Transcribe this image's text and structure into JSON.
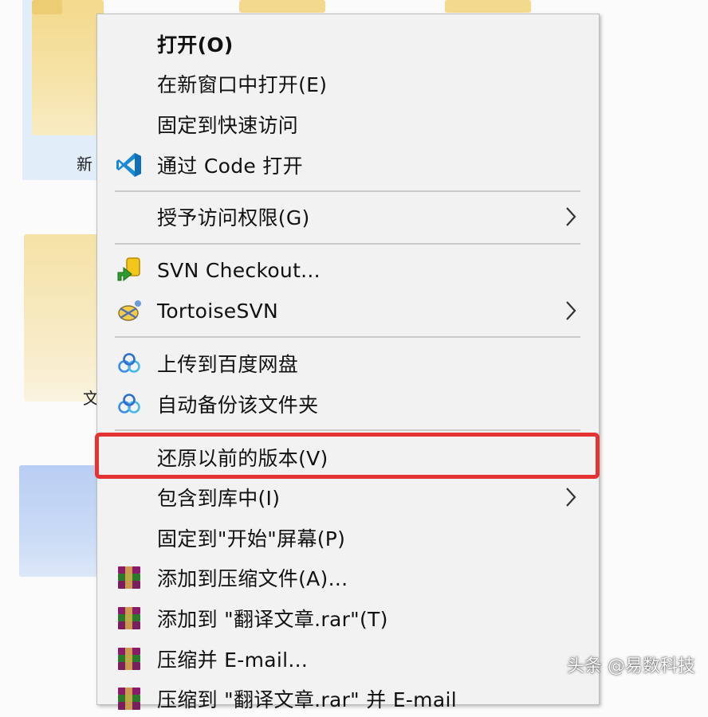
{
  "background": {
    "label_1": "新",
    "label_2": "文"
  },
  "menu": {
    "items": [
      {
        "label": "打开(O)",
        "icon": "none"
      },
      {
        "label": "在新窗口中打开(E)",
        "icon": "none"
      },
      {
        "label": "固定到快速访问",
        "icon": "none"
      },
      {
        "label": "通过 Code 打开",
        "icon": "vscode-icon"
      },
      {
        "label": "授予访问权限(G)",
        "icon": "none",
        "submenu": true
      },
      {
        "label": "SVN Checkout...",
        "icon": "svn-checkout-icon"
      },
      {
        "label": "TortoiseSVN",
        "icon": "tortoisesvn-icon",
        "submenu": true
      },
      {
        "label": "上传到百度网盘",
        "icon": "baidu-netdisk-icon"
      },
      {
        "label": "自动备份该文件夹",
        "icon": "baidu-netdisk-icon"
      },
      {
        "label": "还原以前的版本(V)",
        "icon": "none"
      },
      {
        "label": "包含到库中(I)",
        "icon": "none",
        "submenu": true
      },
      {
        "label": "固定到\"开始\"屏幕(P)",
        "icon": "none"
      },
      {
        "label": "添加到压缩文件(A)...",
        "icon": "winrar-icon"
      },
      {
        "label": "添加到 \"翻译文章.rar\"(T)",
        "icon": "winrar-icon"
      },
      {
        "label": "压缩并 E-mail...",
        "icon": "winrar-icon"
      },
      {
        "label": "压缩到 \"翻译文章.rar\" 并 E-mail",
        "icon": "winrar-icon"
      }
    ]
  },
  "watermark": "头条 @易数科技",
  "colors": {
    "highlight": "#e53333",
    "menu_bg": "#f2f2f2"
  }
}
